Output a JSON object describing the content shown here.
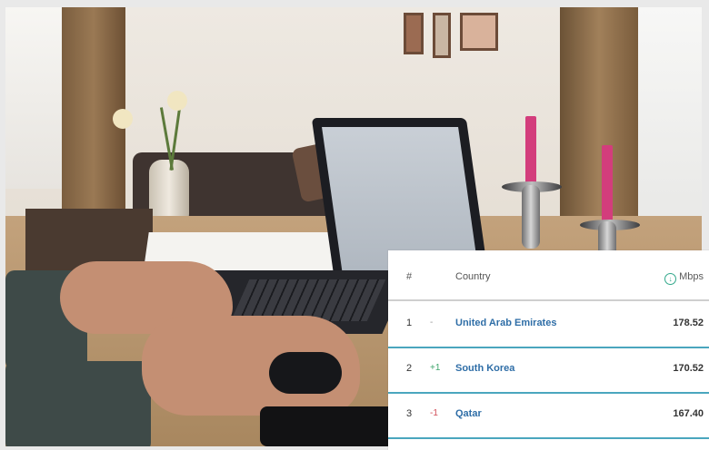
{
  "table": {
    "headers": {
      "rank": "#",
      "country": "Country",
      "speed": "Mbps"
    },
    "rows": [
      {
        "rank": "1",
        "change": "-",
        "country": "United Arab Emirates",
        "speed": "178.52"
      },
      {
        "rank": "2",
        "change": "+1",
        "country": "South Korea",
        "speed": "170.52"
      },
      {
        "rank": "3",
        "change": "-1",
        "country": "Qatar",
        "speed": "167.40"
      }
    ]
  },
  "colors": {
    "link_blue": "#2f6ea7",
    "divider_teal": "#4aa6be",
    "up_green": "#3ea56b",
    "down_red": "#d14d57"
  },
  "icons": {
    "speed_icon": "download-speed-icon"
  }
}
